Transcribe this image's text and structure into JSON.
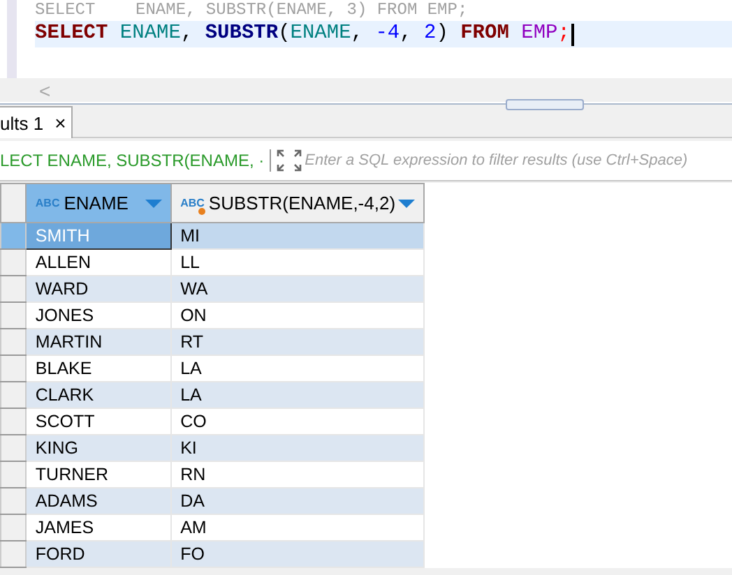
{
  "editor": {
    "lines": [
      {
        "current": false,
        "tokens": [
          {
            "kind": "faded",
            "text": "SELECT    ENAME, SUBSTR(ENAME, 3) FROM EMP;"
          }
        ]
      },
      {
        "current": true,
        "tokens": [
          {
            "kind": "keyword",
            "text": "SELECT "
          },
          {
            "kind": "column",
            "text": "ENAME"
          },
          {
            "kind": "plain",
            "text": ", "
          },
          {
            "kind": "function",
            "text": "SUBSTR"
          },
          {
            "kind": "plain",
            "text": "("
          },
          {
            "kind": "column",
            "text": "ENAME"
          },
          {
            "kind": "plain",
            "text": ", "
          },
          {
            "kind": "number",
            "text": "-4"
          },
          {
            "kind": "plain",
            "text": ", "
          },
          {
            "kind": "number",
            "text": "2"
          },
          {
            "kind": "plain",
            "text": ") "
          },
          {
            "kind": "keyword",
            "text": "FROM "
          },
          {
            "kind": "table",
            "text": "EMP"
          },
          {
            "kind": "delimiter",
            "text": ";"
          }
        ]
      }
    ],
    "scroll_left": "<"
  },
  "results_tab": {
    "label": "ults 1",
    "close": "×",
    "selected": true
  },
  "filter": {
    "query": "LECT ENAME, SUBSTR(ENAME, ·",
    "placeholder": "Enter a SQL expression to filter results (use Ctrl+Space)"
  },
  "table": {
    "columns": [
      {
        "label": "ENAME",
        "selected": true,
        "type_badge": "ABC"
      },
      {
        "label": "SUBSTR(ENAME,-4,2)",
        "selected": false,
        "type_badge": "ABC"
      }
    ],
    "rows": [
      {
        "cells": [
          "SMITH",
          "MI"
        ],
        "selected": true
      },
      {
        "cells": [
          "ALLEN",
          "LL"
        ],
        "selected": false
      },
      {
        "cells": [
          "WARD",
          "WA"
        ],
        "selected": false
      },
      {
        "cells": [
          "JONES",
          "ON"
        ],
        "selected": false
      },
      {
        "cells": [
          "MARTIN",
          "RT"
        ],
        "selected": false
      },
      {
        "cells": [
          "BLAKE",
          "LA"
        ],
        "selected": false
      },
      {
        "cells": [
          "CLARK",
          "LA"
        ],
        "selected": false
      },
      {
        "cells": [
          "SCOTT",
          "CO"
        ],
        "selected": false
      },
      {
        "cells": [
          "KING",
          "KI"
        ],
        "selected": false
      },
      {
        "cells": [
          "TURNER",
          "RN"
        ],
        "selected": false
      },
      {
        "cells": [
          "ADAMS",
          "DA"
        ],
        "selected": false
      },
      {
        "cells": [
          "JAMES",
          "AM"
        ],
        "selected": false
      },
      {
        "cells": [
          "FORD",
          "FO"
        ],
        "selected": false
      }
    ]
  }
}
